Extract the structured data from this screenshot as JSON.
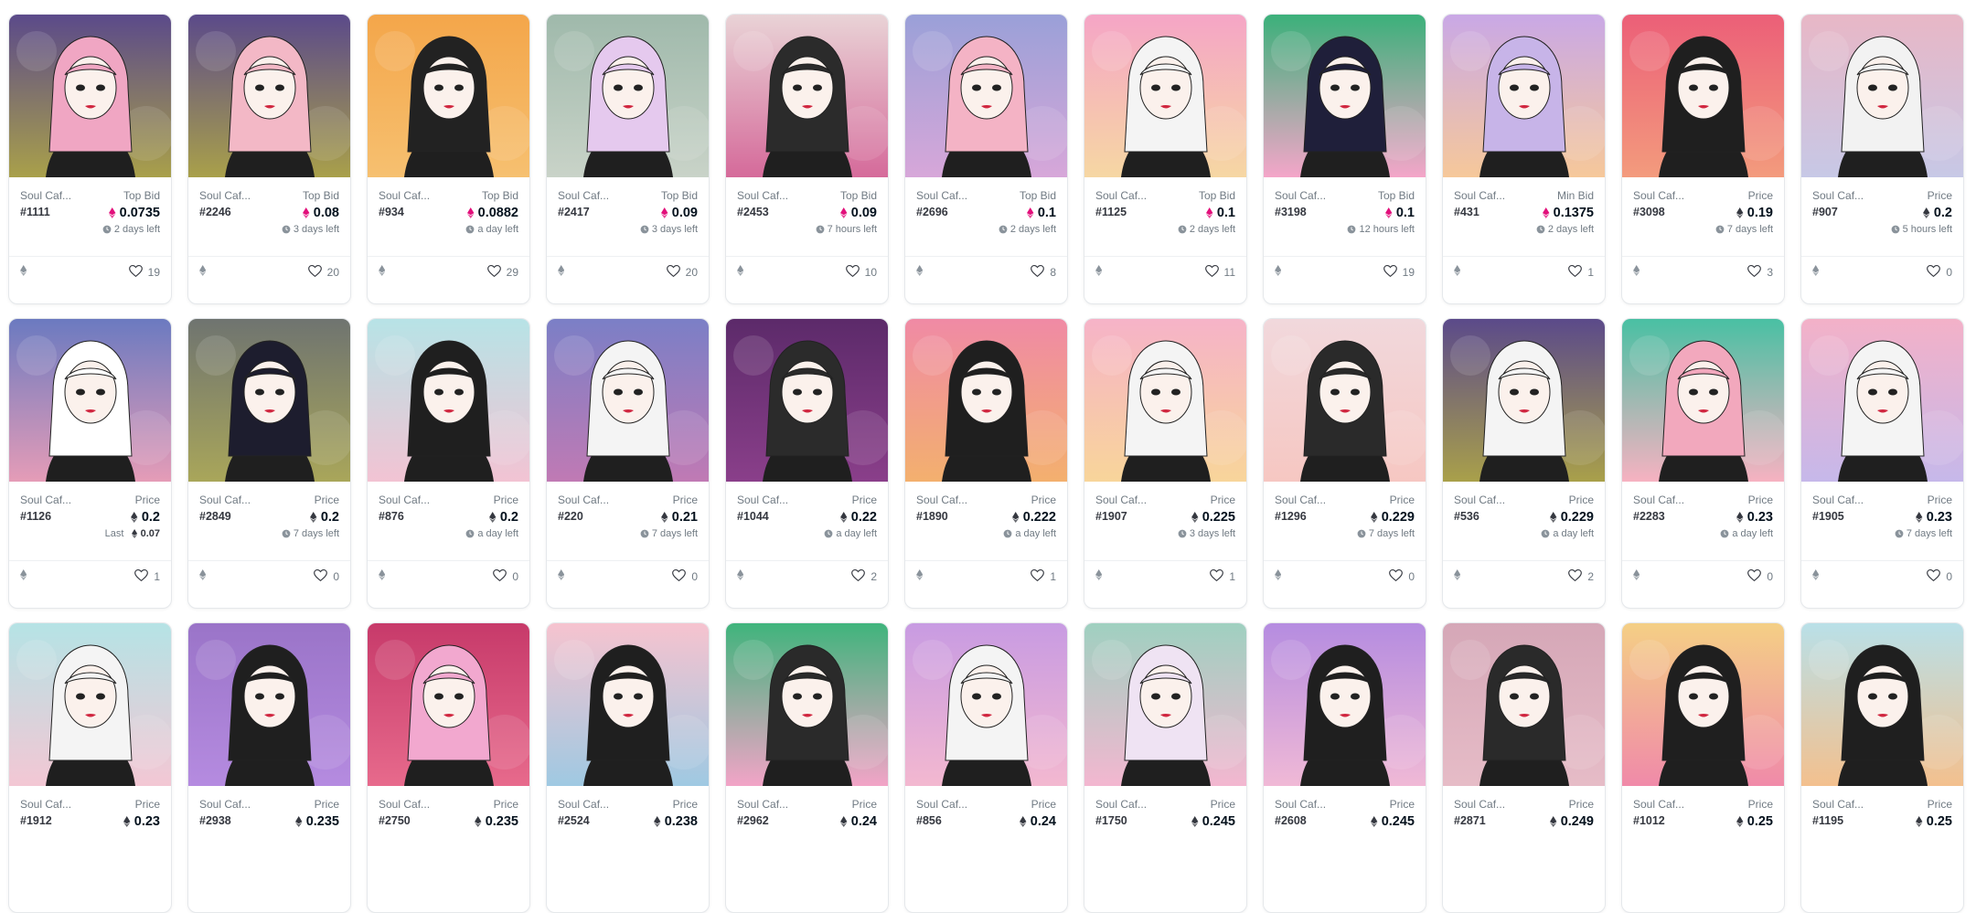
{
  "cards": [
    {
      "collection": "Soul Caf...",
      "token": "#1111",
      "label": "Top Bid",
      "price": "0.0735",
      "currency": "weth",
      "sub": "2 days left",
      "subtype": "time",
      "likes": "19",
      "bg": [
        "#5b4a8a",
        "#a9a04a"
      ],
      "hair": "#f0a6c3"
    },
    {
      "collection": "Soul Caf...",
      "token": "#2246",
      "label": "Top Bid",
      "price": "0.08",
      "currency": "weth",
      "sub": "3 days left",
      "subtype": "time",
      "likes": "20",
      "bg": [
        "#5b4a8a",
        "#a9a04a"
      ],
      "hair": "#f3b8c6"
    },
    {
      "collection": "Soul Caf...",
      "token": "#934",
      "label": "Top Bid",
      "price": "0.0882",
      "currency": "weth",
      "sub": "a day left",
      "subtype": "time",
      "likes": "29",
      "bg": [
        "#f4a64a",
        "#f6c070"
      ],
      "hair": "#222222"
    },
    {
      "collection": "Soul Caf...",
      "token": "#2417",
      "label": "Top Bid",
      "price": "0.09",
      "currency": "weth",
      "sub": "3 days left",
      "subtype": "time",
      "likes": "20",
      "bg": [
        "#9fb9ab",
        "#c9d3c8"
      ],
      "hair": "#e5c9ee"
    },
    {
      "collection": "Soul Caf...",
      "token": "#2453",
      "label": "Top Bid",
      "price": "0.09",
      "currency": "weth",
      "sub": "7 hours left",
      "subtype": "time",
      "likes": "10",
      "bg": [
        "#e9d3d6",
        "#d56a9a"
      ],
      "hair": "#2b2b2b"
    },
    {
      "collection": "Soul Caf...",
      "token": "#2696",
      "label": "Top Bid",
      "price": "0.1",
      "currency": "weth",
      "sub": "2 days left",
      "subtype": "time",
      "likes": "8",
      "bg": [
        "#9aa0d8",
        "#d7a7d9"
      ],
      "hair": "#f4b3c5"
    },
    {
      "collection": "Soul Caf...",
      "token": "#1125",
      "label": "Top Bid",
      "price": "0.1",
      "currency": "weth",
      "sub": "2 days left",
      "subtype": "time",
      "likes": "11",
      "bg": [
        "#f5a5c6",
        "#f6d7a3"
      ],
      "hair": "#f4f4f4"
    },
    {
      "collection": "Soul Caf...",
      "token": "#3198",
      "label": "Top Bid",
      "price": "0.1",
      "currency": "weth",
      "sub": "12 hours left",
      "subtype": "time",
      "likes": "19",
      "bg": [
        "#3bb07a",
        "#f4a6c9"
      ],
      "hair": "#1f1f3a"
    },
    {
      "collection": "Soul Caf...",
      "token": "#431",
      "label": "Min Bid",
      "price": "0.1375",
      "currency": "weth",
      "sub": "2 days left",
      "subtype": "time",
      "likes": "1",
      "bg": [
        "#c9a8e6",
        "#f6c89a"
      ],
      "hair": "#c7b4e8"
    },
    {
      "collection": "Soul Caf...",
      "token": "#3098",
      "label": "Price",
      "price": "0.19",
      "currency": "eth",
      "sub": "7 days left",
      "subtype": "time",
      "likes": "3",
      "bg": [
        "#ec5f78",
        "#f39b7d"
      ],
      "hair": "#1f1f1f"
    },
    {
      "collection": "Soul Caf...",
      "token": "#907",
      "label": "Price",
      "price": "0.2",
      "currency": "eth",
      "sub": "5 hours left",
      "subtype": "time",
      "likes": "0",
      "bg": [
        "#e8b7c6",
        "#c7c8e6"
      ],
      "hair": "#f2f2f2"
    },
    {
      "collection": "Soul Caf...",
      "token": "#1126",
      "label": "Price",
      "price": "0.2",
      "currency": "eth",
      "sub": "0.07",
      "subtype": "last",
      "sublabel": "Last",
      "likes": "1",
      "bg": [
        "#6b7ac0",
        "#e59cb7"
      ],
      "hair": "#ffffff"
    },
    {
      "collection": "Soul Caf...",
      "token": "#2849",
      "label": "Price",
      "price": "0.2",
      "currency": "eth",
      "sub": "7 days left",
      "subtype": "time",
      "likes": "0",
      "bg": [
        "#6f7470",
        "#a9a65a"
      ],
      "hair": "#1d1d2e"
    },
    {
      "collection": "Soul Caf...",
      "token": "#876",
      "label": "Price",
      "price": "0.2",
      "currency": "eth",
      "sub": "a day left",
      "subtype": "time",
      "likes": "0",
      "bg": [
        "#b7e3e6",
        "#f2c3d3"
      ],
      "hair": "#1f1f1f"
    },
    {
      "collection": "Soul Caf...",
      "token": "#220",
      "label": "Price",
      "price": "0.21",
      "currency": "eth",
      "sub": "7 days left",
      "subtype": "time",
      "likes": "0",
      "bg": [
        "#7b7fc6",
        "#c07ab4"
      ],
      "hair": "#f4f4f4"
    },
    {
      "collection": "Soul Caf...",
      "token": "#1044",
      "label": "Price",
      "price": "0.22",
      "currency": "eth",
      "sub": "a day left",
      "subtype": "time",
      "likes": "2",
      "bg": [
        "#5c2a6a",
        "#8a3f8a"
      ],
      "hair": "#2b2b2b"
    },
    {
      "collection": "Soul Caf...",
      "token": "#1890",
      "label": "Price",
      "price": "0.222",
      "currency": "eth",
      "sub": "a day left",
      "subtype": "time",
      "likes": "1",
      "bg": [
        "#f08aa5",
        "#f3b06e"
      ],
      "hair": "#1f1f1f"
    },
    {
      "collection": "Soul Caf...",
      "token": "#1907",
      "label": "Price",
      "price": "0.225",
      "currency": "eth",
      "sub": "3 days left",
      "subtype": "time",
      "likes": "1",
      "bg": [
        "#f6b3c8",
        "#f8d59a"
      ],
      "hair": "#f4f4f4"
    },
    {
      "collection": "Soul Caf...",
      "token": "#1296",
      "label": "Price",
      "price": "0.229",
      "currency": "eth",
      "sub": "7 days left",
      "subtype": "time",
      "likes": "0",
      "bg": [
        "#f1d8dc",
        "#f6c7c2"
      ],
      "hair": "#2a2a2a"
    },
    {
      "collection": "Soul Caf...",
      "token": "#536",
      "label": "Price",
      "price": "0.229",
      "currency": "eth",
      "sub": "a day left",
      "subtype": "time",
      "likes": "2",
      "bg": [
        "#5b4a8a",
        "#a9a04a"
      ],
      "hair": "#f4f4f4"
    },
    {
      "collection": "Soul Caf...",
      "token": "#2283",
      "label": "Price",
      "price": "0.23",
      "currency": "eth",
      "sub": "a day left",
      "subtype": "time",
      "likes": "0",
      "bg": [
        "#49c0a3",
        "#f6b2c1"
      ],
      "hair": "#f2a8bd"
    },
    {
      "collection": "Soul Caf...",
      "token": "#1905",
      "label": "Price",
      "price": "0.23",
      "currency": "eth",
      "sub": "7 days left",
      "subtype": "time",
      "likes": "0",
      "bg": [
        "#f3b1c8",
        "#c6b8ea"
      ],
      "hair": "#f4f4f4"
    },
    {
      "collection": "Soul Caf...",
      "token": "#1912",
      "label": "Price",
      "price": "0.23",
      "currency": "eth",
      "sub": "",
      "subtype": "none",
      "likes": "",
      "bg": [
        "#b5e3e5",
        "#f3c7d4"
      ],
      "hair": "#f4f4f4"
    },
    {
      "collection": "Soul Caf...",
      "token": "#2938",
      "label": "Price",
      "price": "0.235",
      "currency": "eth",
      "sub": "",
      "subtype": "none",
      "likes": "",
      "bg": [
        "#9a74c8",
        "#b58be0"
      ],
      "hair": "#1f1f1f"
    },
    {
      "collection": "Soul Caf...",
      "token": "#2750",
      "label": "Price",
      "price": "0.235",
      "currency": "eth",
      "sub": "",
      "subtype": "none",
      "likes": "",
      "bg": [
        "#c73a6a",
        "#e76a8c"
      ],
      "hair": "#f2a8cf"
    },
    {
      "collection": "Soul Caf...",
      "token": "#2524",
      "label": "Price",
      "price": "0.238",
      "currency": "eth",
      "sub": "",
      "subtype": "none",
      "likes": "",
      "bg": [
        "#f6c3cf",
        "#9fc9e2"
      ],
      "hair": "#1f1f1f"
    },
    {
      "collection": "Soul Caf...",
      "token": "#2962",
      "label": "Price",
      "price": "0.24",
      "currency": "eth",
      "sub": "",
      "subtype": "none",
      "likes": "",
      "bg": [
        "#3fb47c",
        "#f2a4c7"
      ],
      "hair": "#2a2a2a"
    },
    {
      "collection": "Soul Caf...",
      "token": "#856",
      "label": "Price",
      "price": "0.24",
      "currency": "eth",
      "sub": "",
      "subtype": "none",
      "likes": "",
      "bg": [
        "#c89be2",
        "#f3b8d0"
      ],
      "hair": "#f4f4f4"
    },
    {
      "collection": "Soul Caf...",
      "token": "#1750",
      "label": "Price",
      "price": "0.245",
      "currency": "eth",
      "sub": "",
      "subtype": "none",
      "likes": "",
      "bg": [
        "#9fd0c0",
        "#f3b7d0"
      ],
      "hair": "#efe3f3"
    },
    {
      "collection": "Soul Caf...",
      "token": "#2608",
      "label": "Price",
      "price": "0.245",
      "currency": "eth",
      "sub": "",
      "subtype": "none",
      "likes": "",
      "bg": [
        "#b58ce0",
        "#f0b9d6"
      ],
      "hair": "#1f1f1f"
    },
    {
      "collection": "Soul Caf...",
      "token": "#2871",
      "label": "Price",
      "price": "0.249",
      "currency": "eth",
      "sub": "",
      "subtype": "none",
      "likes": "",
      "bg": [
        "#d5a7b7",
        "#e6bcc7"
      ],
      "hair": "#2a2a2a"
    },
    {
      "collection": "Soul Caf...",
      "token": "#1012",
      "label": "Price",
      "price": "0.25",
      "currency": "eth",
      "sub": "",
      "subtype": "none",
      "likes": "",
      "bg": [
        "#f4cf85",
        "#f08aa9"
      ],
      "hair": "#1f1f1f"
    },
    {
      "collection": "Soul Caf...",
      "token": "#1195",
      "label": "Price",
      "price": "0.25",
      "currency": "eth",
      "sub": "",
      "subtype": "none",
      "likes": "",
      "bg": [
        "#b9e0e8",
        "#f3c08e"
      ],
      "hair": "#1f1f1f"
    }
  ],
  "colors": {
    "weth": "#e2107b",
    "eth": "#353840",
    "muted": "#707a83"
  },
  "icons": {
    "footer_left": "ethereum-icon",
    "footer_right": "heart-icon",
    "time": "clock-icon",
    "weth": "weth-diamond-icon",
    "eth": "eth-diamond-icon"
  }
}
